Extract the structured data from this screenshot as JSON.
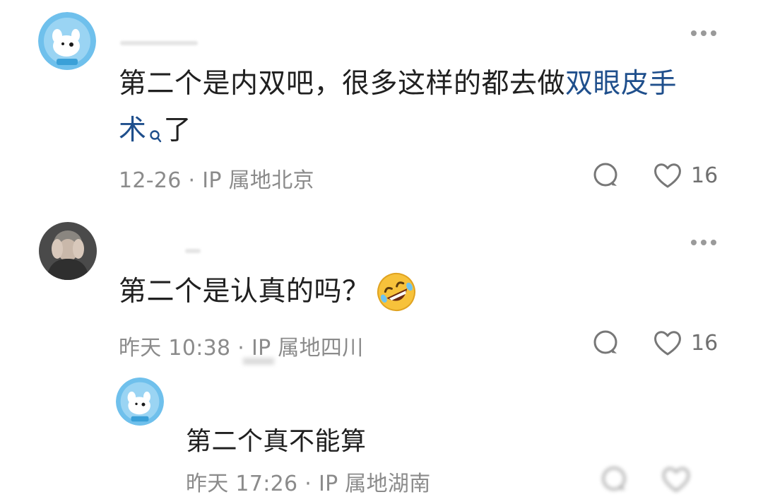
{
  "comments": [
    {
      "text_prefix": "第二个是内双吧，很多这样的都去做",
      "link_part1": "双眼皮手",
      "link_part2": "术",
      "text_suffix": "了",
      "date": "12-26",
      "ip": "IP 属地北京",
      "likes": "16",
      "link_icon": "search-icon",
      "avatar_icon": "blue-dog-avatar"
    },
    {
      "text": "第二个是认真的吗？",
      "emoji": "rofl-emoji",
      "date": "昨天 10:38",
      "ip": "IP 属地四川",
      "likes": "16",
      "avatar_icon": "photo-avatar"
    }
  ],
  "reply": {
    "text": "第二个真不能算",
    "date": "昨天 17:26",
    "ip": "IP 属地湖南",
    "avatar_icon": "blue-dog-avatar"
  },
  "separator": "·",
  "colors": {
    "link": "#1f4f8c",
    "meta": "#8b8b8b",
    "text": "#202020",
    "avatar_bg": "#59b6e8"
  }
}
